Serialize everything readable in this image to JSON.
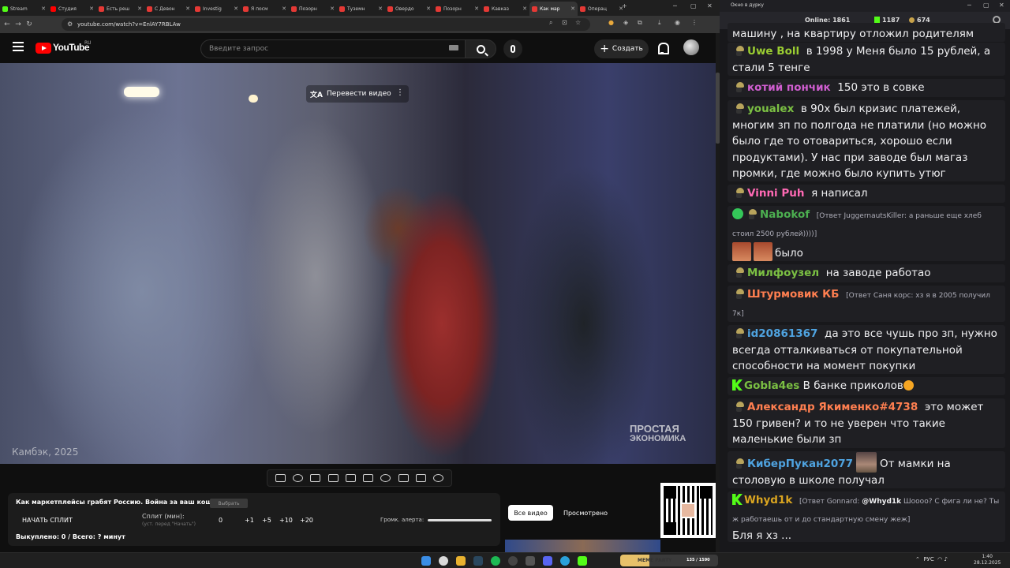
{
  "browser": {
    "tabs": [
      {
        "title": "Stream",
        "fav": "#53fc18"
      },
      {
        "title": "Студия",
        "fav": "#ff0000"
      },
      {
        "title": "Есть реш",
        "fav": "#e53935"
      },
      {
        "title": "С Девон",
        "fav": "#e53935"
      },
      {
        "title": "Investig",
        "fav": "#e53935"
      },
      {
        "title": "Я посм",
        "fav": "#e53935"
      },
      {
        "title": "Позорн",
        "fav": "#e53935"
      },
      {
        "title": "Туземн",
        "fav": "#e53935"
      },
      {
        "title": "Овердо",
        "fav": "#e53935"
      },
      {
        "title": "Позорн",
        "fav": "#e53935"
      },
      {
        "title": "Кавказ",
        "fav": "#e53935"
      },
      {
        "title": "Как мар",
        "fav": "#e53935",
        "active": true
      },
      {
        "title": "Операц",
        "fav": "#e53935"
      }
    ],
    "url": "youtube.com/watch?v=EnlAY7RBLAw"
  },
  "youtube": {
    "logo_text": "YouTube",
    "country": "RU",
    "search_placeholder": "Введите запрос",
    "create_label": "Создать"
  },
  "video": {
    "translate_label": "Перевести видео",
    "overlay_year": "Камбэк, 2025",
    "watermark_line1": "ПРОСТАЯ",
    "watermark_line2": "ЭКОНОМИКА"
  },
  "panel": {
    "title": "Как маркетплейсы грабят Россию. Война за ваш кошелек",
    "small_btn": "Выбрать",
    "split_btn": "НАЧАТЬ СПЛИТ",
    "split_min_label": "Сплит (мин):",
    "split_hint": "(уст. перед \"Начать\")",
    "split_value": "0",
    "increments": [
      "+1",
      "+5",
      "+10",
      "+20"
    ],
    "alert_label": "Громк. алерта:",
    "alert_volume": 1.0,
    "bought": "Выкуплено: 0 / Всего: ? минут",
    "all_videos": "Все видео",
    "watched": "Просмотрено"
  },
  "chat_window": {
    "title": "Окно в дурку",
    "online_label": "Online:",
    "online": "1861",
    "k_count": "1187",
    "coin_count": "674"
  },
  "chat": [
    {
      "nick": "",
      "text": "машину , на квартиру отложил родителям",
      "color": "#efeff1"
    },
    {
      "nick": "Uwe Boll",
      "color": "#9acd32",
      "badge": "hat",
      "text": "в 1998 у Меня было 15 рублей, а стали 5 тенге"
    },
    {
      "nick": "котий пончик",
      "color": "#d05ed0",
      "badge": "hat",
      "text": "150 это в совке"
    },
    {
      "nick": "youalex",
      "color": "#7bc043",
      "badge": "hat",
      "text": "в 90х был кризис платежей, многим зп по полгода не платили (но можно было где то отовариться, хорошо если продуктами). У нас при заводе был магаз промки, где можно было купить утюг например, за счет невыплаченной зп"
    },
    {
      "nick": "Vinni Puh",
      "color": "#ff69b4",
      "badge": "hat",
      "text": "я написал"
    },
    {
      "nick": "Nabokof",
      "color": "#4caf50",
      "badge": "hat",
      "reply": "[Ответ JuggernautsKiller: а раньше еще хлеб стоил 2500 рублей))))]",
      "text": "было"
    },
    {
      "nick": "Милфоузел",
      "color": "#7bc043",
      "badge": "hat",
      "text": "на заводе работао"
    },
    {
      "nick": "Штурмовик КБ",
      "color": "#ff7f50",
      "badge": "hat",
      "reply": "[Ответ Саня корс: хз я в 2005 получил 7к]",
      "text": ""
    },
    {
      "nick": "id20861367",
      "color": "#4fa3e0",
      "badge": "hat",
      "text": "да это все чушь про зп, нужно всегда отталкиваться от покупательной способности на момент покупки"
    },
    {
      "nick": "Gobla4es",
      "color": "#7bc043",
      "badge": "kk",
      "text": "В банке приколов"
    },
    {
      "nick": "Александр Якименко#4738",
      "color": "#ff7f50",
      "badge": "hat",
      "text": "это может 150 гривен? и то не уверен что такие маленькие были зп"
    },
    {
      "nick": "КиберПукан2077",
      "color": "#4fa3e0",
      "badge": "hat",
      "text": "От мамки на столовую в школе получал"
    },
    {
      "nick": "Whyd1k",
      "color": "#daa520",
      "badge": "kk",
      "reply_prefix": "[Ответ Gonnard: ",
      "reply_mention": "@Whyd1k",
      "reply_rest": " Шоооо? С фига ли не? Ты ж работаешь от и до стандартную смену жеж]",
      "text": "Бля я хз ..."
    }
  ],
  "taskbar": {
    "meme_label": "MEME PARTY",
    "meme_counter": "135 / 1590",
    "lang": "РУС",
    "time": "1:40",
    "date": "28.12.2025"
  }
}
